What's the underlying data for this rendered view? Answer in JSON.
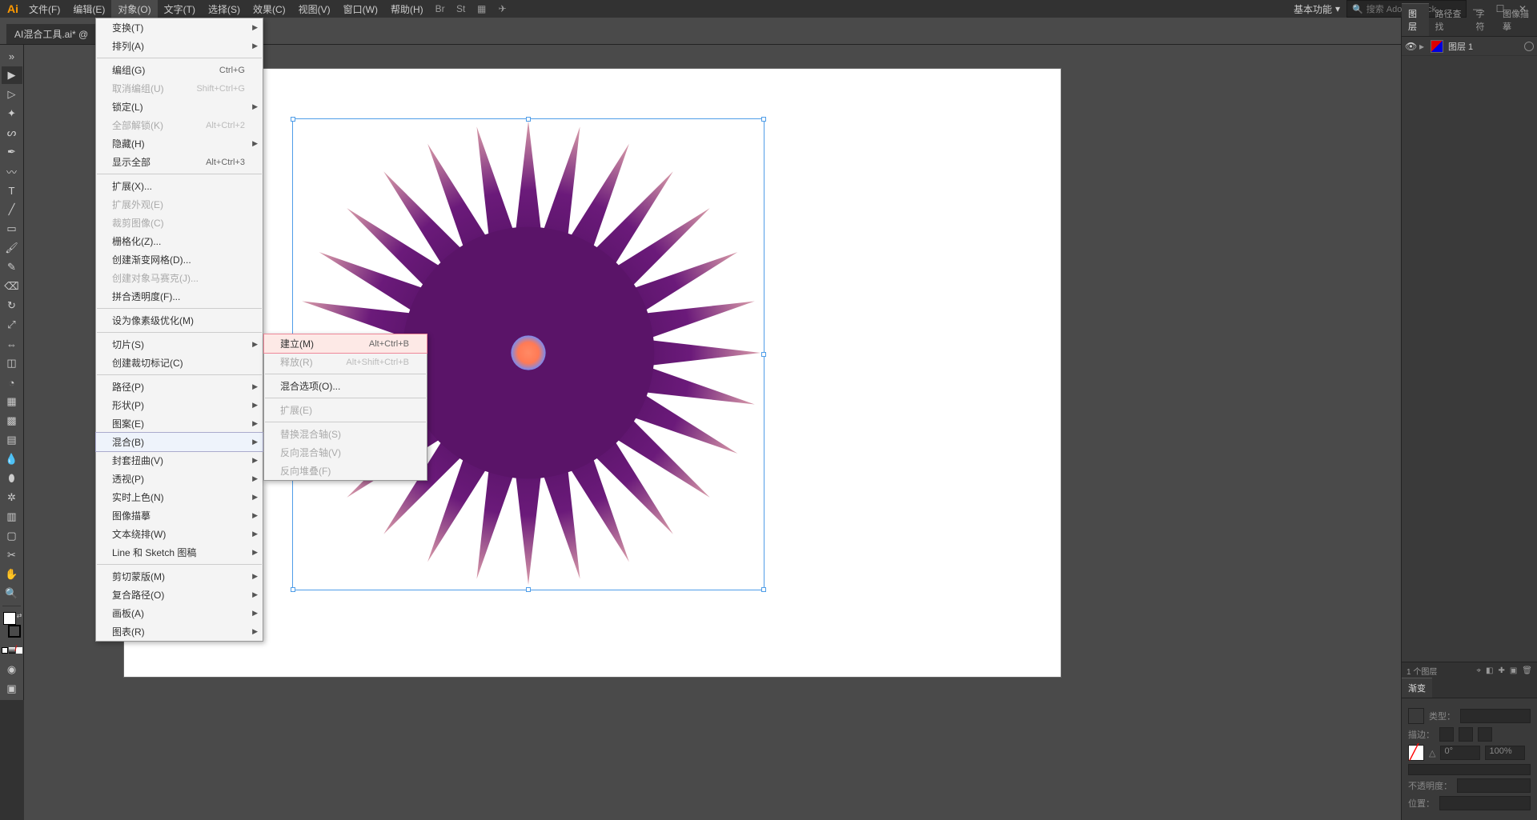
{
  "app": {
    "logo": "Ai"
  },
  "menubar": {
    "items": [
      "文件(F)",
      "编辑(E)",
      "对象(O)",
      "文字(T)",
      "选择(S)",
      "效果(C)",
      "视图(V)",
      "窗口(W)",
      "帮助(H)"
    ],
    "active_index": 2,
    "workspace": "基本功能",
    "search_placeholder": "搜索 Adobe Stock"
  },
  "doc_tab": "AI混合工具.ai* @",
  "object_menu": [
    {
      "label": "变换(T)",
      "sub": true
    },
    {
      "label": "排列(A)",
      "sub": true
    },
    {
      "sep": true
    },
    {
      "label": "编组(G)",
      "shortcut": "Ctrl+G"
    },
    {
      "label": "取消编组(U)",
      "shortcut": "Shift+Ctrl+G",
      "disabled": true
    },
    {
      "label": "锁定(L)",
      "sub": true
    },
    {
      "label": "全部解锁(K)",
      "shortcut": "Alt+Ctrl+2",
      "disabled": true
    },
    {
      "label": "隐藏(H)",
      "sub": true
    },
    {
      "label": "显示全部",
      "shortcut": "Alt+Ctrl+3"
    },
    {
      "sep": true
    },
    {
      "label": "扩展(X)..."
    },
    {
      "label": "扩展外观(E)",
      "disabled": true
    },
    {
      "label": "裁剪图像(C)",
      "disabled": true
    },
    {
      "label": "栅格化(Z)..."
    },
    {
      "label": "创建渐变网格(D)..."
    },
    {
      "label": "创建对象马赛克(J)...",
      "disabled": true
    },
    {
      "label": "拼合透明度(F)..."
    },
    {
      "sep": true
    },
    {
      "label": "设为像素级优化(M)"
    },
    {
      "sep": true
    },
    {
      "label": "切片(S)",
      "sub": true
    },
    {
      "label": "创建裁切标记(C)"
    },
    {
      "sep": true
    },
    {
      "label": "路径(P)",
      "sub": true
    },
    {
      "label": "形状(P)",
      "sub": true
    },
    {
      "label": "图案(E)",
      "sub": true
    },
    {
      "label": "混合(B)",
      "sub": true,
      "hi": true
    },
    {
      "label": "封套扭曲(V)",
      "sub": true
    },
    {
      "label": "透视(P)",
      "sub": true
    },
    {
      "label": "实时上色(N)",
      "sub": true
    },
    {
      "label": "图像描摹",
      "sub": true
    },
    {
      "label": "文本绕排(W)",
      "sub": true
    },
    {
      "label": "Line 和 Sketch 图稿",
      "sub": true
    },
    {
      "sep": true
    },
    {
      "label": "剪切蒙版(M)",
      "sub": true
    },
    {
      "label": "复合路径(O)",
      "sub": true
    },
    {
      "label": "画板(A)",
      "sub": true
    },
    {
      "label": "图表(R)",
      "sub": true
    }
  ],
  "blend_submenu": [
    {
      "label": "建立(M)",
      "shortcut": "Alt+Ctrl+B",
      "hi": true
    },
    {
      "label": "释放(R)",
      "shortcut": "Alt+Shift+Ctrl+B",
      "disabled": true
    },
    {
      "sep": true
    },
    {
      "label": "混合选项(O)..."
    },
    {
      "sep": true
    },
    {
      "label": "扩展(E)",
      "disabled": true
    },
    {
      "sep": true
    },
    {
      "label": "替换混合轴(S)",
      "disabled": true
    },
    {
      "label": "反向混合轴(V)",
      "disabled": true
    },
    {
      "label": "反向堆叠(F)",
      "disabled": true
    }
  ],
  "panels": {
    "tabs": [
      "图层",
      "路径查找",
      "字符",
      "图像描摹"
    ],
    "active_tab": 0,
    "layer_name": "图层 1",
    "footer": "1 个图层",
    "gradient": {
      "title": "渐变",
      "type_label": "类型：",
      "stroke_label": "描边：",
      "angle_prefix": "△",
      "angle_value": "0°",
      "ratio_value": "100%",
      "opacity_label": "不透明度：",
      "position_label": "位置："
    }
  },
  "tools": [
    "selection",
    "direct-selection",
    "magic-wand",
    "lasso",
    "pen",
    "curvature",
    "type",
    "line",
    "rectangle",
    "paintbrush",
    "shaper",
    "eraser",
    "rotate",
    "scale",
    "width",
    "free-transform",
    "shape-builder",
    "perspective",
    "mesh",
    "gradient",
    "eyedropper",
    "blend",
    "symbol-sprayer",
    "column-graph",
    "artboard",
    "slice",
    "hand",
    "zoom"
  ]
}
